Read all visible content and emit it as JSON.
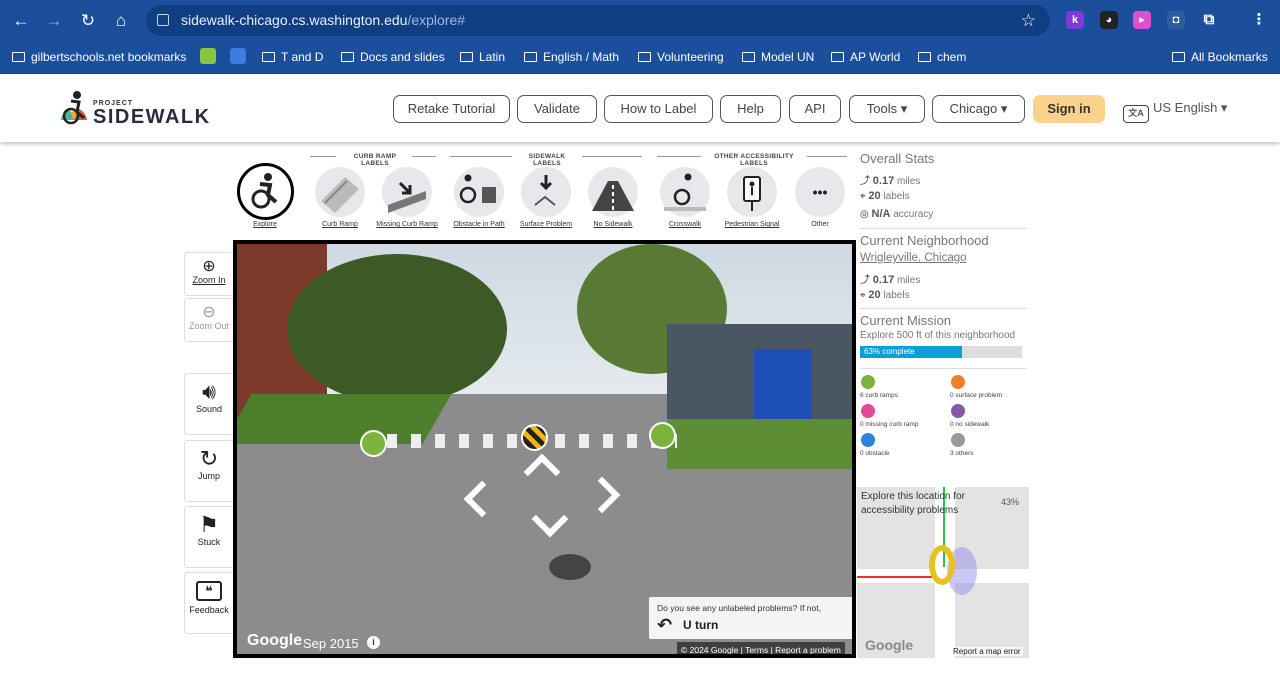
{
  "browser": {
    "url_host": "sidewalk-chicago.cs.washington.edu",
    "url_path": "/explore#",
    "bookmarks": [
      {
        "label": "gilbertschools.net bookmarks"
      },
      {
        "label": "T and D"
      },
      {
        "label": "Docs and slides"
      },
      {
        "label": "Latin"
      },
      {
        "label": "English / Math"
      },
      {
        "label": "Volunteering"
      },
      {
        "label": "Model UN"
      },
      {
        "label": "AP World"
      },
      {
        "label": "chem"
      }
    ],
    "all_bookmarks": "All Bookmarks",
    "ext_k": "k"
  },
  "header": {
    "logo_project": "PROJECT",
    "logo_sidewalk": "SIDEWALK",
    "buttons": {
      "retake": "Retake Tutorial",
      "validate": "Validate",
      "how_to_label": "How to Label",
      "help": "Help",
      "api": "API",
      "tools": "Tools ▾",
      "city": "Chicago ▾"
    },
    "signin": "Sign in",
    "language": "US English ▾"
  },
  "toolbar": {
    "groups": {
      "curb": "CURB RAMP LABELS",
      "sidewalk": "SIDEWALK LABELS",
      "other": "OTHER ACCESSIBILITY LABELS"
    },
    "tools": {
      "explore": "Explore",
      "curb_ramp": "Curb Ramp",
      "missing_curb_ramp": "Missing Curb Ramp",
      "obstacle": "Obstacle in Path",
      "surface": "Surface Problem",
      "no_sidewalk": "No Sidewalk",
      "crosswalk": "Crosswalk",
      "ped_signal": "Pedestrian Signal",
      "other": "Other"
    },
    "other_icon_glyph": "•••"
  },
  "side_controls": {
    "zoom_in": "Zoom In",
    "zoom_out": "Zoom Out",
    "sound": "Sound",
    "jump": "Jump",
    "stuck": "Stuck",
    "feedback": "Feedback"
  },
  "pano": {
    "google": "Google",
    "date": "Sep 2015",
    "info_glyph": "i",
    "credit": "© 2024 Google  |  Terms  |  Report a problem",
    "uturn_question": "Do you see any unlabeled problems? If not,",
    "uturn_label": "U turn"
  },
  "stats": {
    "overall_title": "Overall Stats",
    "overall_miles_value": "0.17",
    "overall_miles_unit": "miles",
    "overall_labels_value": "20",
    "overall_labels_unit": "labels",
    "overall_accuracy_value": "N/A",
    "overall_accuracy_unit": "accuracy",
    "neighborhood_title": "Current Neighborhood",
    "neighborhood_name": "Wrigleyville, Chicago",
    "nb_miles_value": "0.17",
    "nb_miles_unit": "miles",
    "nb_labels_value": "20",
    "nb_labels_unit": "labels",
    "mission_title": "Current Mission",
    "mission_text": "Explore 500 ft of this neighborhood",
    "mission_progress": 0.63,
    "mission_progress_label": "63% complete"
  },
  "legend": [
    {
      "label": "6 curb ramps",
      "color": "#7bb43b"
    },
    {
      "label": "0 surface problem",
      "color": "#f07f2b"
    },
    {
      "label": "0 missing curb ramp",
      "color": "#e24b9b"
    },
    {
      "label": "0 no sidewalk",
      "color": "#8a56a8"
    },
    {
      "label": "0 obstacle",
      "color": "#2c82dc"
    },
    {
      "label": "3 others",
      "color": "#999999"
    }
  ],
  "minimap": {
    "prompt": "Explore this location for accessibility problems",
    "percent": "43%",
    "google": "Google",
    "report": "Report a map error"
  }
}
